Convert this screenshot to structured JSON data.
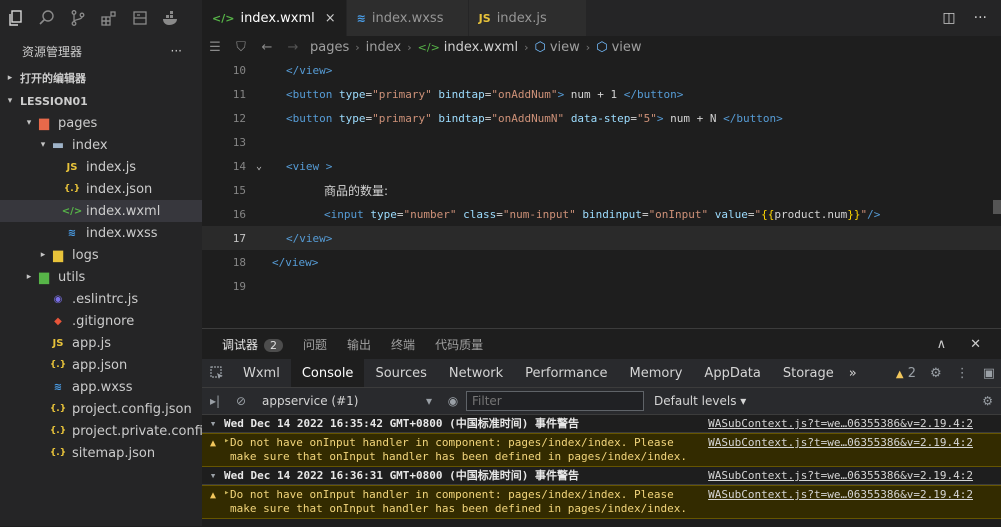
{
  "explorer": {
    "title": "资源管理器",
    "more": "···",
    "open_editors": "打开的编辑器",
    "project": "LESSION01",
    "tree": [
      {
        "label": "pages",
        "indent": 22,
        "twist": "▾",
        "icon": "folder-pages",
        "color": "#e8694a"
      },
      {
        "label": "index",
        "indent": 36,
        "twist": "▾",
        "icon": "folder-open",
        "color": "#9fb3c8"
      },
      {
        "label": "index.js",
        "indent": 50,
        "twist": "",
        "icon": "js",
        "color": "#e8c33a"
      },
      {
        "label": "index.json",
        "indent": 50,
        "twist": "",
        "icon": "json",
        "color": "#e8c33a"
      },
      {
        "label": "index.wxml",
        "indent": 50,
        "twist": "",
        "icon": "wxml",
        "color": "#57b548",
        "selected": true
      },
      {
        "label": "index.wxss",
        "indent": 50,
        "twist": "",
        "icon": "wxss",
        "color": "#4a9ee8"
      },
      {
        "label": "logs",
        "indent": 36,
        "twist": "▸",
        "icon": "folder",
        "color": "#e8c33a"
      },
      {
        "label": "utils",
        "indent": 22,
        "twist": "▸",
        "icon": "folder-utils",
        "color": "#57b548"
      },
      {
        "label": ".eslintrc.js",
        "indent": 36,
        "twist": "",
        "icon": "eslint",
        "color": "#7a6fe8"
      },
      {
        "label": ".gitignore",
        "indent": 36,
        "twist": "",
        "icon": "git",
        "color": "#e8553a"
      },
      {
        "label": "app.js",
        "indent": 36,
        "twist": "",
        "icon": "js",
        "color": "#e8c33a"
      },
      {
        "label": "app.json",
        "indent": 36,
        "twist": "",
        "icon": "json",
        "color": "#e8c33a"
      },
      {
        "label": "app.wxss",
        "indent": 36,
        "twist": "",
        "icon": "wxss",
        "color": "#4a9ee8"
      },
      {
        "label": "project.config.json",
        "indent": 36,
        "twist": "",
        "icon": "json",
        "color": "#e8c33a"
      },
      {
        "label": "project.private.config.js...",
        "indent": 36,
        "twist": "",
        "icon": "json",
        "color": "#e8c33a"
      },
      {
        "label": "sitemap.json",
        "indent": 36,
        "twist": "",
        "icon": "json",
        "color": "#e8c33a"
      }
    ]
  },
  "tabs": [
    {
      "label": "index.wxml",
      "active": true,
      "close": "×"
    },
    {
      "label": "index.wxss",
      "active": false
    },
    {
      "label": "index.js",
      "active": false
    }
  ],
  "breadcrumb": [
    "pages",
    "index",
    "index.wxml",
    "view",
    "view"
  ],
  "code": [
    {
      "n": "10",
      "html": "<span class='t-tag'>&lt;/view&gt;</span>",
      "indent": 84
    },
    {
      "n": "11",
      "html": "<span class='t-tag'>&lt;button </span><span class='t-attr'>type</span><span class='t-text'>=</span><span class='t-str'>\"primary\"</span> <span class='t-attr'>bindtap</span><span class='t-text'>=</span><span class='t-str'>\"onAddNum\"</span><span class='t-tag'>&gt;</span><span class='t-text'> num + 1 </span><span class='t-tag'>&lt;/button&gt;</span>",
      "indent": 84
    },
    {
      "n": "12",
      "html": "<span class='t-tag'>&lt;button </span><span class='t-attr'>type</span><span class='t-text'>=</span><span class='t-str'>\"primary\"</span> <span class='t-attr'>bindtap</span><span class='t-text'>=</span><span class='t-str'>\"onAddNumN\"</span> <span class='t-attr'>data-step</span><span class='t-text'>=</span><span class='t-str'>\"5\"</span><span class='t-tag'>&gt;</span><span class='t-text'> num + N </span><span class='t-tag'>&lt;/button&gt;</span>",
      "indent": 84
    },
    {
      "n": "13",
      "html": "",
      "indent": 84
    },
    {
      "n": "14",
      "html": "<span class='t-tag'>&lt;view &gt;</span>",
      "indent": 84,
      "fold": "⌄"
    },
    {
      "n": "15",
      "html": "<span class='t-zh'>商品的数量:</span>",
      "indent": 122
    },
    {
      "n": "16",
      "html": "<span class='t-tag'>&lt;input </span><span class='t-attr'>type</span><span class='t-text'>=</span><span class='t-str'>\"number\"</span> <span class='t-attr'>class</span><span class='t-text'>=</span><span class='t-str'>\"num-input\"</span> <span class='t-attr'>bindinput</span><span class='t-text'>=</span><span class='t-str'>\"onInput\"</span> <span class='t-attr'>value</span><span class='t-text'>=</span><span class='t-str'>\"</span><span class='t-br'>{{</span><span class='t-text'>product.num</span><span class='t-br'>}}</span><span class='t-str'>\"</span><span class='t-tag'>/&gt;</span>",
      "indent": 122
    },
    {
      "n": "17",
      "html": "<span class='t-tag'>&lt;/view&gt;</span>",
      "indent": 84,
      "current": true
    },
    {
      "n": "18",
      "html": "<span class='t-tag'>&lt;/view&gt;</span>",
      "indent": 70
    },
    {
      "n": "19",
      "html": "",
      "indent": 70
    }
  ],
  "panel": {
    "tabs": [
      "调试器",
      "问题",
      "输出",
      "终端",
      "代码质量"
    ],
    "badge": "2",
    "devtools_tabs": [
      "Wxml",
      "Console",
      "Sources",
      "Network",
      "Performance",
      "Memory",
      "AppData",
      "Storage"
    ],
    "more_tabs": "»",
    "warn_count": "2",
    "context": "appservice (#1)",
    "filter_placeholder": "Filter",
    "levels": "Default levels ▾",
    "logs": [
      {
        "type": "head",
        "text": "Wed Dec 14 2022 16:35:42 GMT+0800 (中国标准时间) 事件警告",
        "src": "WASubContext.js?t=we…06355386&v=2.19.4:2"
      },
      {
        "type": "warn",
        "text": "Do not have onInput handler in component: pages/index/index. Please\nmake sure that onInput handler has been defined in pages/index/index.",
        "src": "WASubContext.js?t=we…06355386&v=2.19.4:2"
      },
      {
        "type": "head",
        "text": "Wed Dec 14 2022 16:36:31 GMT+0800 (中国标准时间) 事件警告",
        "src": "WASubContext.js?t=we…06355386&v=2.19.4:2"
      },
      {
        "type": "warn",
        "text": "Do not have onInput handler in component: pages/index/index. Please\nmake sure that onInput handler has been defined in pages/index/index.",
        "src": "WASubContext.js?t=we…06355386&v=2.19.4:2"
      }
    ]
  }
}
